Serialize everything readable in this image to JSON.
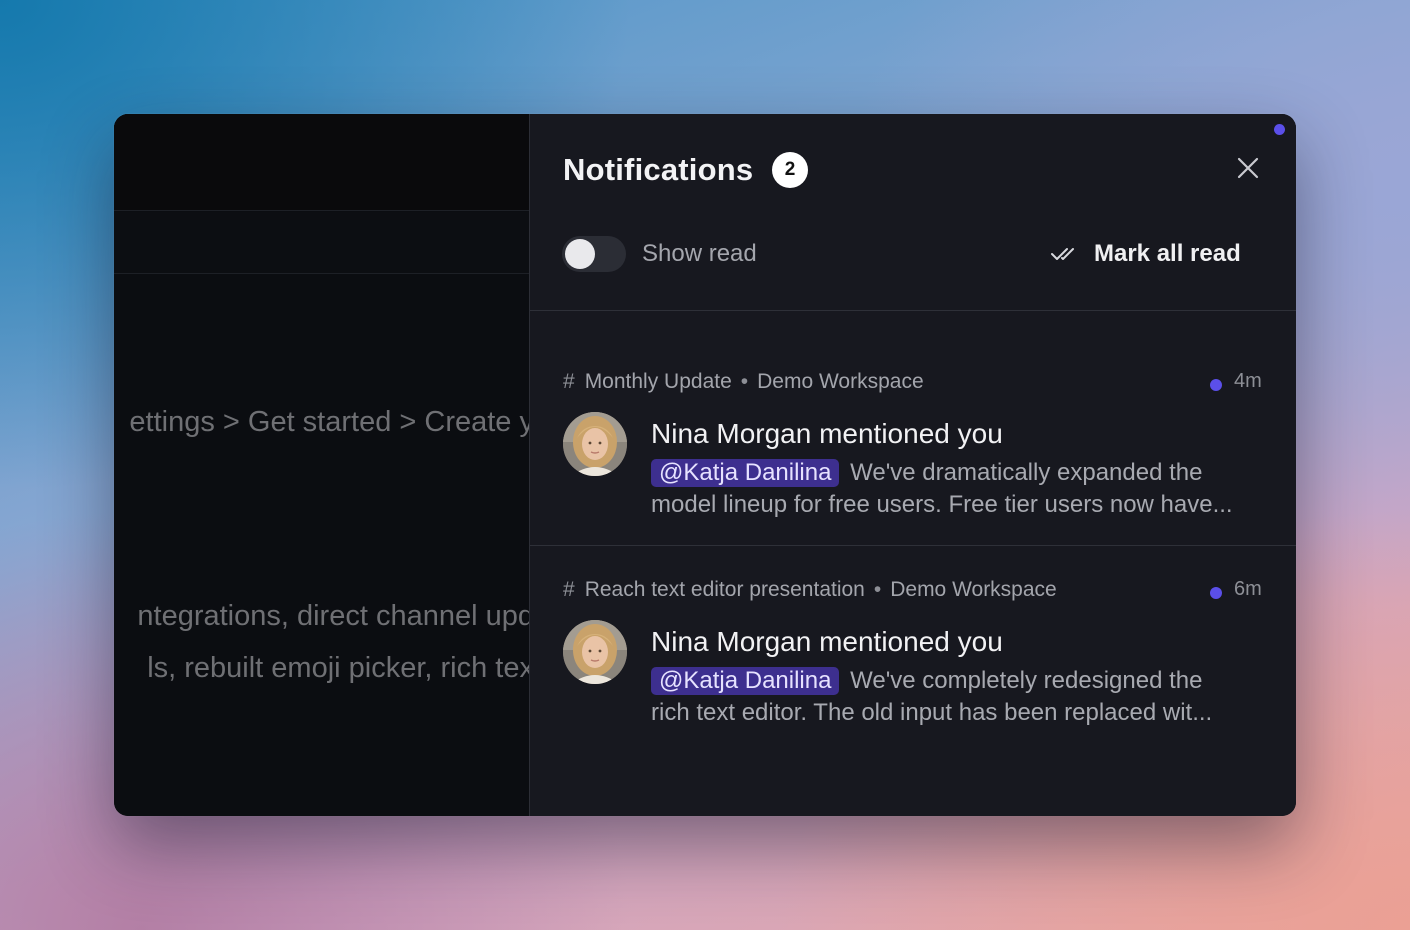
{
  "background_app": {
    "breadcrumb": "ettings > Get started > Create y",
    "line1": "ntegrations, direct channel upd",
    "line2": "ls, rebuilt emoji picker, rich tex"
  },
  "panel": {
    "title": "Notifications",
    "unread_count": "2",
    "close_icon": "close-icon",
    "show_read_label": "Show read",
    "show_read_enabled": false,
    "mark_all_label": "Mark all read",
    "mark_all_icon": "double-check-icon",
    "accent_color": "#5b4fe9"
  },
  "notifications": [
    {
      "channel": "Monthly Update",
      "workspace": "Demo Workspace",
      "time": "4m",
      "unread": true,
      "headline": "Nina Morgan mentioned you",
      "mention": "@Katja Danilina",
      "preview_line1": "We've dramatically expanded the",
      "preview_line2": "model lineup for free users. Free tier users now have..."
    },
    {
      "channel": "Reach text editor presentation",
      "workspace": "Demo Workspace",
      "time": "6m",
      "unread": true,
      "headline": "Nina Morgan mentioned you",
      "mention": "@Katja Danilina",
      "preview_line1": "We've completely redesigned the",
      "preview_line2": "rich text editor. The old input has been replaced wit..."
    }
  ],
  "separator": "•",
  "hash": "#"
}
